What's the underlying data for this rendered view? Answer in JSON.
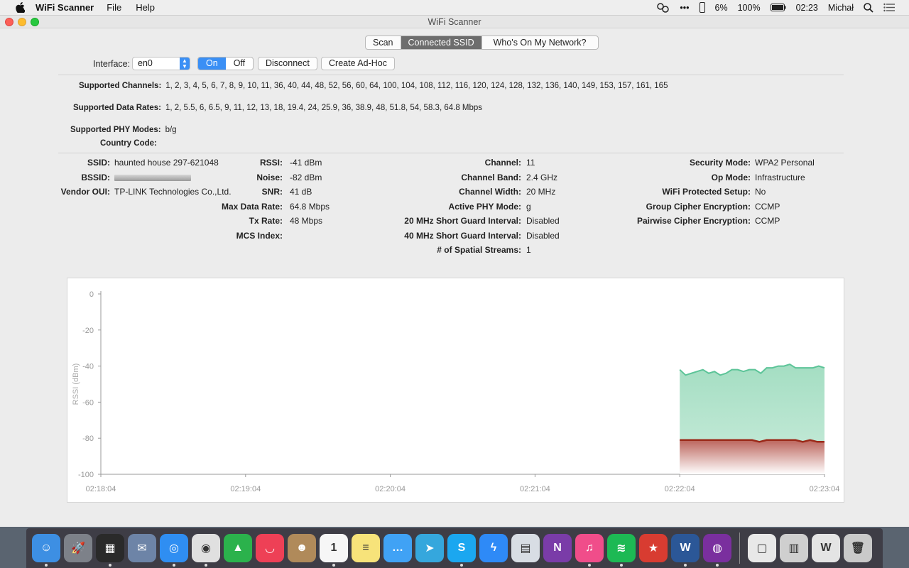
{
  "menubar": {
    "app_name": "WiFi Scanner",
    "menus": [
      "File",
      "Help"
    ],
    "battery_small": "6%",
    "battery_main": "100%",
    "time": "02:23",
    "user": "Michał"
  },
  "window": {
    "title": "WiFi Scanner",
    "tabs": [
      "Scan",
      "Connected SSID",
      "Who's On My Network?"
    ],
    "active_tab": "Connected SSID"
  },
  "toolbar": {
    "interface_label": "Interface:",
    "interface_value": "en0",
    "on_label": "On",
    "off_label": "Off",
    "disconnect_label": "Disconnect",
    "adhoc_label": "Create Ad-Hoc"
  },
  "capabilities": {
    "channels_label": "Supported Channels:",
    "channels_value": "1, 2, 3, 4, 5, 6, 7, 8, 9, 10, 11, 36, 40, 44, 48, 52, 56, 60, 64, 100, 104, 108, 112, 116, 120, 124, 128, 132, 136, 140, 149, 153, 157, 161, 165",
    "rates_label": "Supported Data Rates:",
    "rates_value": "1, 2, 5.5, 6, 6.5, 9, 11, 12, 13, 18, 19.4, 24, 25.9, 36, 38.9, 48, 51.8, 54, 58.3, 64.8 Mbps",
    "phy_label": "Supported PHY Modes:",
    "phy_value": "b/g",
    "country_label": "Country Code:",
    "country_value": ""
  },
  "details": {
    "col1": [
      {
        "k": "SSID:",
        "v": "haunted house 297-621048"
      },
      {
        "k": "BSSID:",
        "v": ""
      },
      {
        "k": "Vendor OUI:",
        "v": "TP-LINK Technologies Co.,Ltd."
      }
    ],
    "col2": [
      {
        "k": "RSSI:",
        "v": "-41 dBm"
      },
      {
        "k": "Noise:",
        "v": "-82 dBm"
      },
      {
        "k": "SNR:",
        "v": "41 dB"
      },
      {
        "k": "Max Data Rate:",
        "v": "64.8 Mbps"
      },
      {
        "k": "Tx Rate:",
        "v": "48 Mbps"
      },
      {
        "k": "MCS Index:",
        "v": ""
      }
    ],
    "col3": [
      {
        "k": "Channel:",
        "v": "11"
      },
      {
        "k": "Channel Band:",
        "v": "2.4 GHz"
      },
      {
        "k": "Channel Width:",
        "v": "20 MHz"
      },
      {
        "k": "Active PHY Mode:",
        "v": "g"
      },
      {
        "k": "20 MHz Short Guard Interval:",
        "v": "Disabled"
      },
      {
        "k": "40 MHz Short Guard Interval:",
        "v": "Disabled"
      },
      {
        "k": "# of Spatial Streams:",
        "v": "1"
      }
    ],
    "col4": [
      {
        "k": "Security Mode:",
        "v": "WPA2 Personal"
      },
      {
        "k": "Op Mode:",
        "v": "Infrastructure"
      },
      {
        "k": "WiFi Protected Setup:",
        "v": "No"
      },
      {
        "k": "Group Cipher Encryption:",
        "v": "CCMP"
      },
      {
        "k": "Pairwise Cipher Encryption:",
        "v": "CCMP"
      }
    ]
  },
  "chart_data": {
    "type": "area",
    "ylabel": "RSSI (dBm)",
    "ylim": [
      -100,
      0
    ],
    "yticks": [
      0,
      -20,
      -40,
      -60,
      -80,
      -100
    ],
    "xticks": [
      "02:18:04",
      "02:19:04",
      "02:20:04",
      "02:21:04",
      "02:22:04",
      "02:23:04"
    ],
    "x_minutes": [
      0,
      1,
      2,
      3,
      4,
      5
    ],
    "series": [
      {
        "name": "RSSI",
        "color": "#5cc498",
        "fill": "#9fdcbf",
        "x": [
          4.0,
          4.04,
          4.08,
          4.12,
          4.16,
          4.2,
          4.24,
          4.28,
          4.32,
          4.36,
          4.4,
          4.44,
          4.48,
          4.52,
          4.56,
          4.6,
          4.64,
          4.68,
          4.72,
          4.76,
          4.8,
          4.84,
          4.88,
          4.92,
          4.96,
          5.0
        ],
        "values": [
          -42,
          -45,
          -44,
          -43,
          -42,
          -44,
          -43,
          -45,
          -44,
          -42,
          -42,
          -43,
          -42,
          -42,
          -44,
          -41,
          -41,
          -40,
          -40,
          -39,
          -41,
          -41,
          -41,
          -41,
          -40,
          -41
        ]
      },
      {
        "name": "Noise",
        "color": "#9b2a1a",
        "fill": "#b04a40",
        "x": [
          4.0,
          4.2,
          4.5,
          4.55,
          4.6,
          4.8,
          4.85,
          4.9,
          4.95,
          5.0
        ],
        "values": [
          -81,
          -81,
          -81,
          -82,
          -81,
          -81,
          -82,
          -81,
          -82,
          -82
        ]
      }
    ]
  },
  "dock": {
    "apps": [
      {
        "name": "finder",
        "color": "#3d8fe3",
        "glyph": "☺"
      },
      {
        "name": "launchpad",
        "color": "#7d8189",
        "glyph": "🚀"
      },
      {
        "name": "photos-app",
        "color": "#2a2a2a",
        "glyph": "▦"
      },
      {
        "name": "mail-bird",
        "color": "#6d84a7",
        "glyph": "✉"
      },
      {
        "name": "safari",
        "color": "#2f8ef2",
        "glyph": "◎"
      },
      {
        "name": "chrome",
        "color": "#e0e0e0",
        "glyph": "◉"
      },
      {
        "name": "feedly",
        "color": "#2bb24c",
        "glyph": "▲"
      },
      {
        "name": "pocket",
        "color": "#ee4056",
        "glyph": "◡"
      },
      {
        "name": "contacts",
        "color": "#b08a5a",
        "glyph": "☻"
      },
      {
        "name": "calendar",
        "color": "#f6f6f6",
        "glyph": "1"
      },
      {
        "name": "notes",
        "color": "#f7e37a",
        "glyph": "≡"
      },
      {
        "name": "messages",
        "color": "#40a2f5",
        "glyph": "…"
      },
      {
        "name": "telegram",
        "color": "#35a7dd",
        "glyph": "➤"
      },
      {
        "name": "skype",
        "color": "#1ba7f0",
        "glyph": "S"
      },
      {
        "name": "messenger",
        "color": "#2e8af7",
        "glyph": "ϟ"
      },
      {
        "name": "preview",
        "color": "#d8dde4",
        "glyph": "▤"
      },
      {
        "name": "onenote",
        "color": "#7a3ca8",
        "glyph": "N"
      },
      {
        "name": "itunes",
        "color": "#f04d8a",
        "glyph": "♫"
      },
      {
        "name": "spotify",
        "color": "#1db954",
        "glyph": "≋"
      },
      {
        "name": "wunderlist",
        "color": "#d83c31",
        "glyph": "★"
      },
      {
        "name": "word",
        "color": "#2b5797",
        "glyph": "W"
      },
      {
        "name": "tor",
        "color": "#7a2f9e",
        "glyph": "◍"
      }
    ],
    "others": [
      {
        "name": "document-stack",
        "color": "#e8e8e8",
        "glyph": "▢"
      },
      {
        "name": "screenshot-stack",
        "color": "#cfcfcf",
        "glyph": "▥"
      },
      {
        "name": "word-document",
        "color": "#e4e4e4",
        "glyph": "W"
      },
      {
        "name": "trash",
        "color": "#c9c9c9",
        "glyph": "🗑"
      }
    ]
  }
}
